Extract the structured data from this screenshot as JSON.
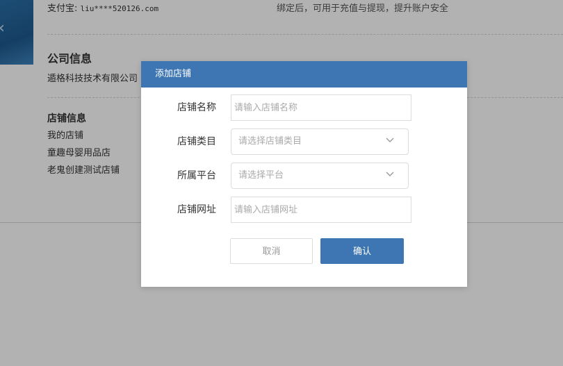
{
  "background": {
    "alipay": {
      "label": "支付宝:",
      "value": "liu****520126.com",
      "hint": "绑定后，可用于充值与提现，提升账户安全"
    },
    "company": {
      "title": "公司信息",
      "name": "遁格科技技术有限公司"
    },
    "shops": {
      "title": "店铺信息",
      "items": [
        "我的店铺",
        "童趣母婴用品店",
        "老鬼创建测试店铺"
      ]
    }
  },
  "modal": {
    "title": "添加店铺",
    "fields": {
      "shop_name": {
        "label": "店铺名称",
        "placeholder": "请输入店铺名称"
      },
      "shop_category": {
        "label": "店铺类目",
        "placeholder": "请选择店铺类目"
      },
      "platform": {
        "label": "所属平台",
        "placeholder": "请选择平台"
      },
      "shop_url": {
        "label": "店铺网址",
        "placeholder": "请输入店铺网址"
      }
    },
    "buttons": {
      "cancel": "取消",
      "confirm": "确认"
    }
  },
  "colors": {
    "accent": "#3d76b2",
    "overlay": "rgba(0,0,0,0.30)"
  },
  "icons": {
    "dropdown": "chevron-down-icon"
  }
}
